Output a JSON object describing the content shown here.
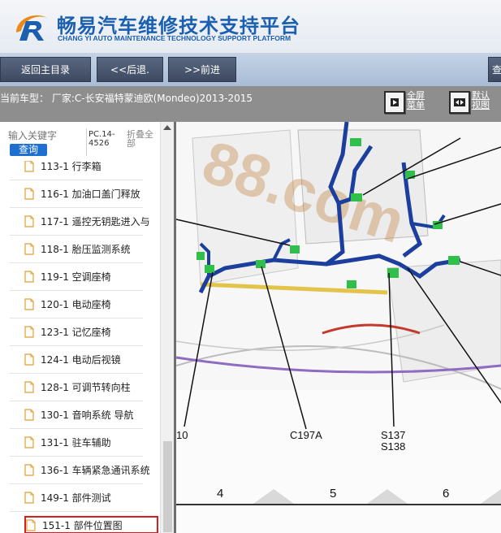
{
  "header": {
    "brand_cn": "畅易汽车维修技术支持平台",
    "brand_en": "CHANG YI AUTO MAINTENANCE TECHNOLOGY SUPPORT PLATFORM",
    "brand_color": "#1a5fb0"
  },
  "nav": {
    "home": "返回主目录",
    "back": "<<后退.",
    "forward": ">>前进",
    "cut_button": "查"
  },
  "vehicle": {
    "text": "当前车型：  厂家:C-长安福特蒙迪欧(Mondeo)2013-2015"
  },
  "tools": {
    "fullscreen": "全屏菜单",
    "default_view": "默认视图"
  },
  "sidebar": {
    "search_placeholder": "输入关键字",
    "search_button": "查询",
    "pc_label": "PC.14-4526",
    "fold_label": "折叠全部",
    "items": [
      {
        "label": "113-1 行李箱"
      },
      {
        "label": "116-1 加油口盖门释放"
      },
      {
        "label": "117-1 遥控无钥匙进入与"
      },
      {
        "label": "118-1 胎压监测系统"
      },
      {
        "label": "119-1 空调座椅"
      },
      {
        "label": "120-1 电动座椅"
      },
      {
        "label": "123-1 记忆座椅"
      },
      {
        "label": "124-1 电动后视镜"
      },
      {
        "label": "128-1 可调节转向柱"
      },
      {
        "label": "130-1 音响系统 导航"
      },
      {
        "label": "131-1 驻车辅助"
      },
      {
        "label": "136-1 车辆紧急通讯系统"
      },
      {
        "label": "149-1 部件测试"
      },
      {
        "label": "151-1 部件位置图"
      }
    ],
    "selected_index": 13
  },
  "diagram": {
    "watermark": "88.com",
    "labels": {
      "left_cut": "10",
      "c197a": "C197A",
      "s137": "S137",
      "s138": "S138"
    },
    "grid_numbers": [
      "4",
      "5",
      "6"
    ],
    "colors": {
      "harness_blue": "#1c3f9e",
      "connector_green": "#2fbf4a",
      "watermark": "#c07a35"
    }
  }
}
